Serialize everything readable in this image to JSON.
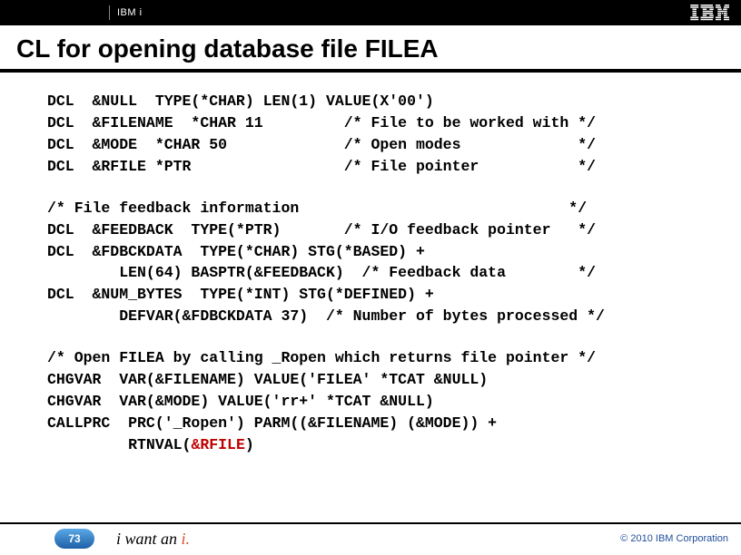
{
  "header": {
    "product": "IBM i",
    "logo_alt": "IBM"
  },
  "title": "CL for opening database file FILEA",
  "code": {
    "block1": "DCL  &NULL  TYPE(*CHAR) LEN(1) VALUE(X'00')\nDCL  &FILENAME  *CHAR 11         /* File to be worked with */\nDCL  &MODE  *CHAR 50             /* Open modes             */\nDCL  &RFILE *PTR                 /* File pointer           */",
    "block2": "/* File feedback information                              */\nDCL  &FEEDBACK  TYPE(*PTR)       /* I/O feedback pointer   */\nDCL  &FDBCKDATA  TYPE(*CHAR) STG(*BASED) +\n        LEN(64) BASPTR(&FEEDBACK)  /* Feedback data        */\nDCL  &NUM_BYTES  TYPE(*INT) STG(*DEFINED) +\n        DEFVAR(&FDBCKDATA 37)  /* Number of bytes processed */",
    "block3_pre": "/* Open FILEA by calling _Ropen which returns file pointer */\nCHGVAR  VAR(&FILENAME) VALUE('FILEA' *TCAT &NULL)\nCHGVAR  VAR(&MODE) VALUE('rr+' *TCAT &NULL)\nCALLPRC  PRC('_Ropen') PARM((&FILENAME) (&MODE)) +\n         RTNVAL(",
    "block3_red": "&RFILE",
    "block3_post": ")"
  },
  "footer": {
    "page": "73",
    "tagline_prefix": "i want an ",
    "tagline_accent": "i.",
    "copyright": "© 2010 IBM Corporation"
  }
}
